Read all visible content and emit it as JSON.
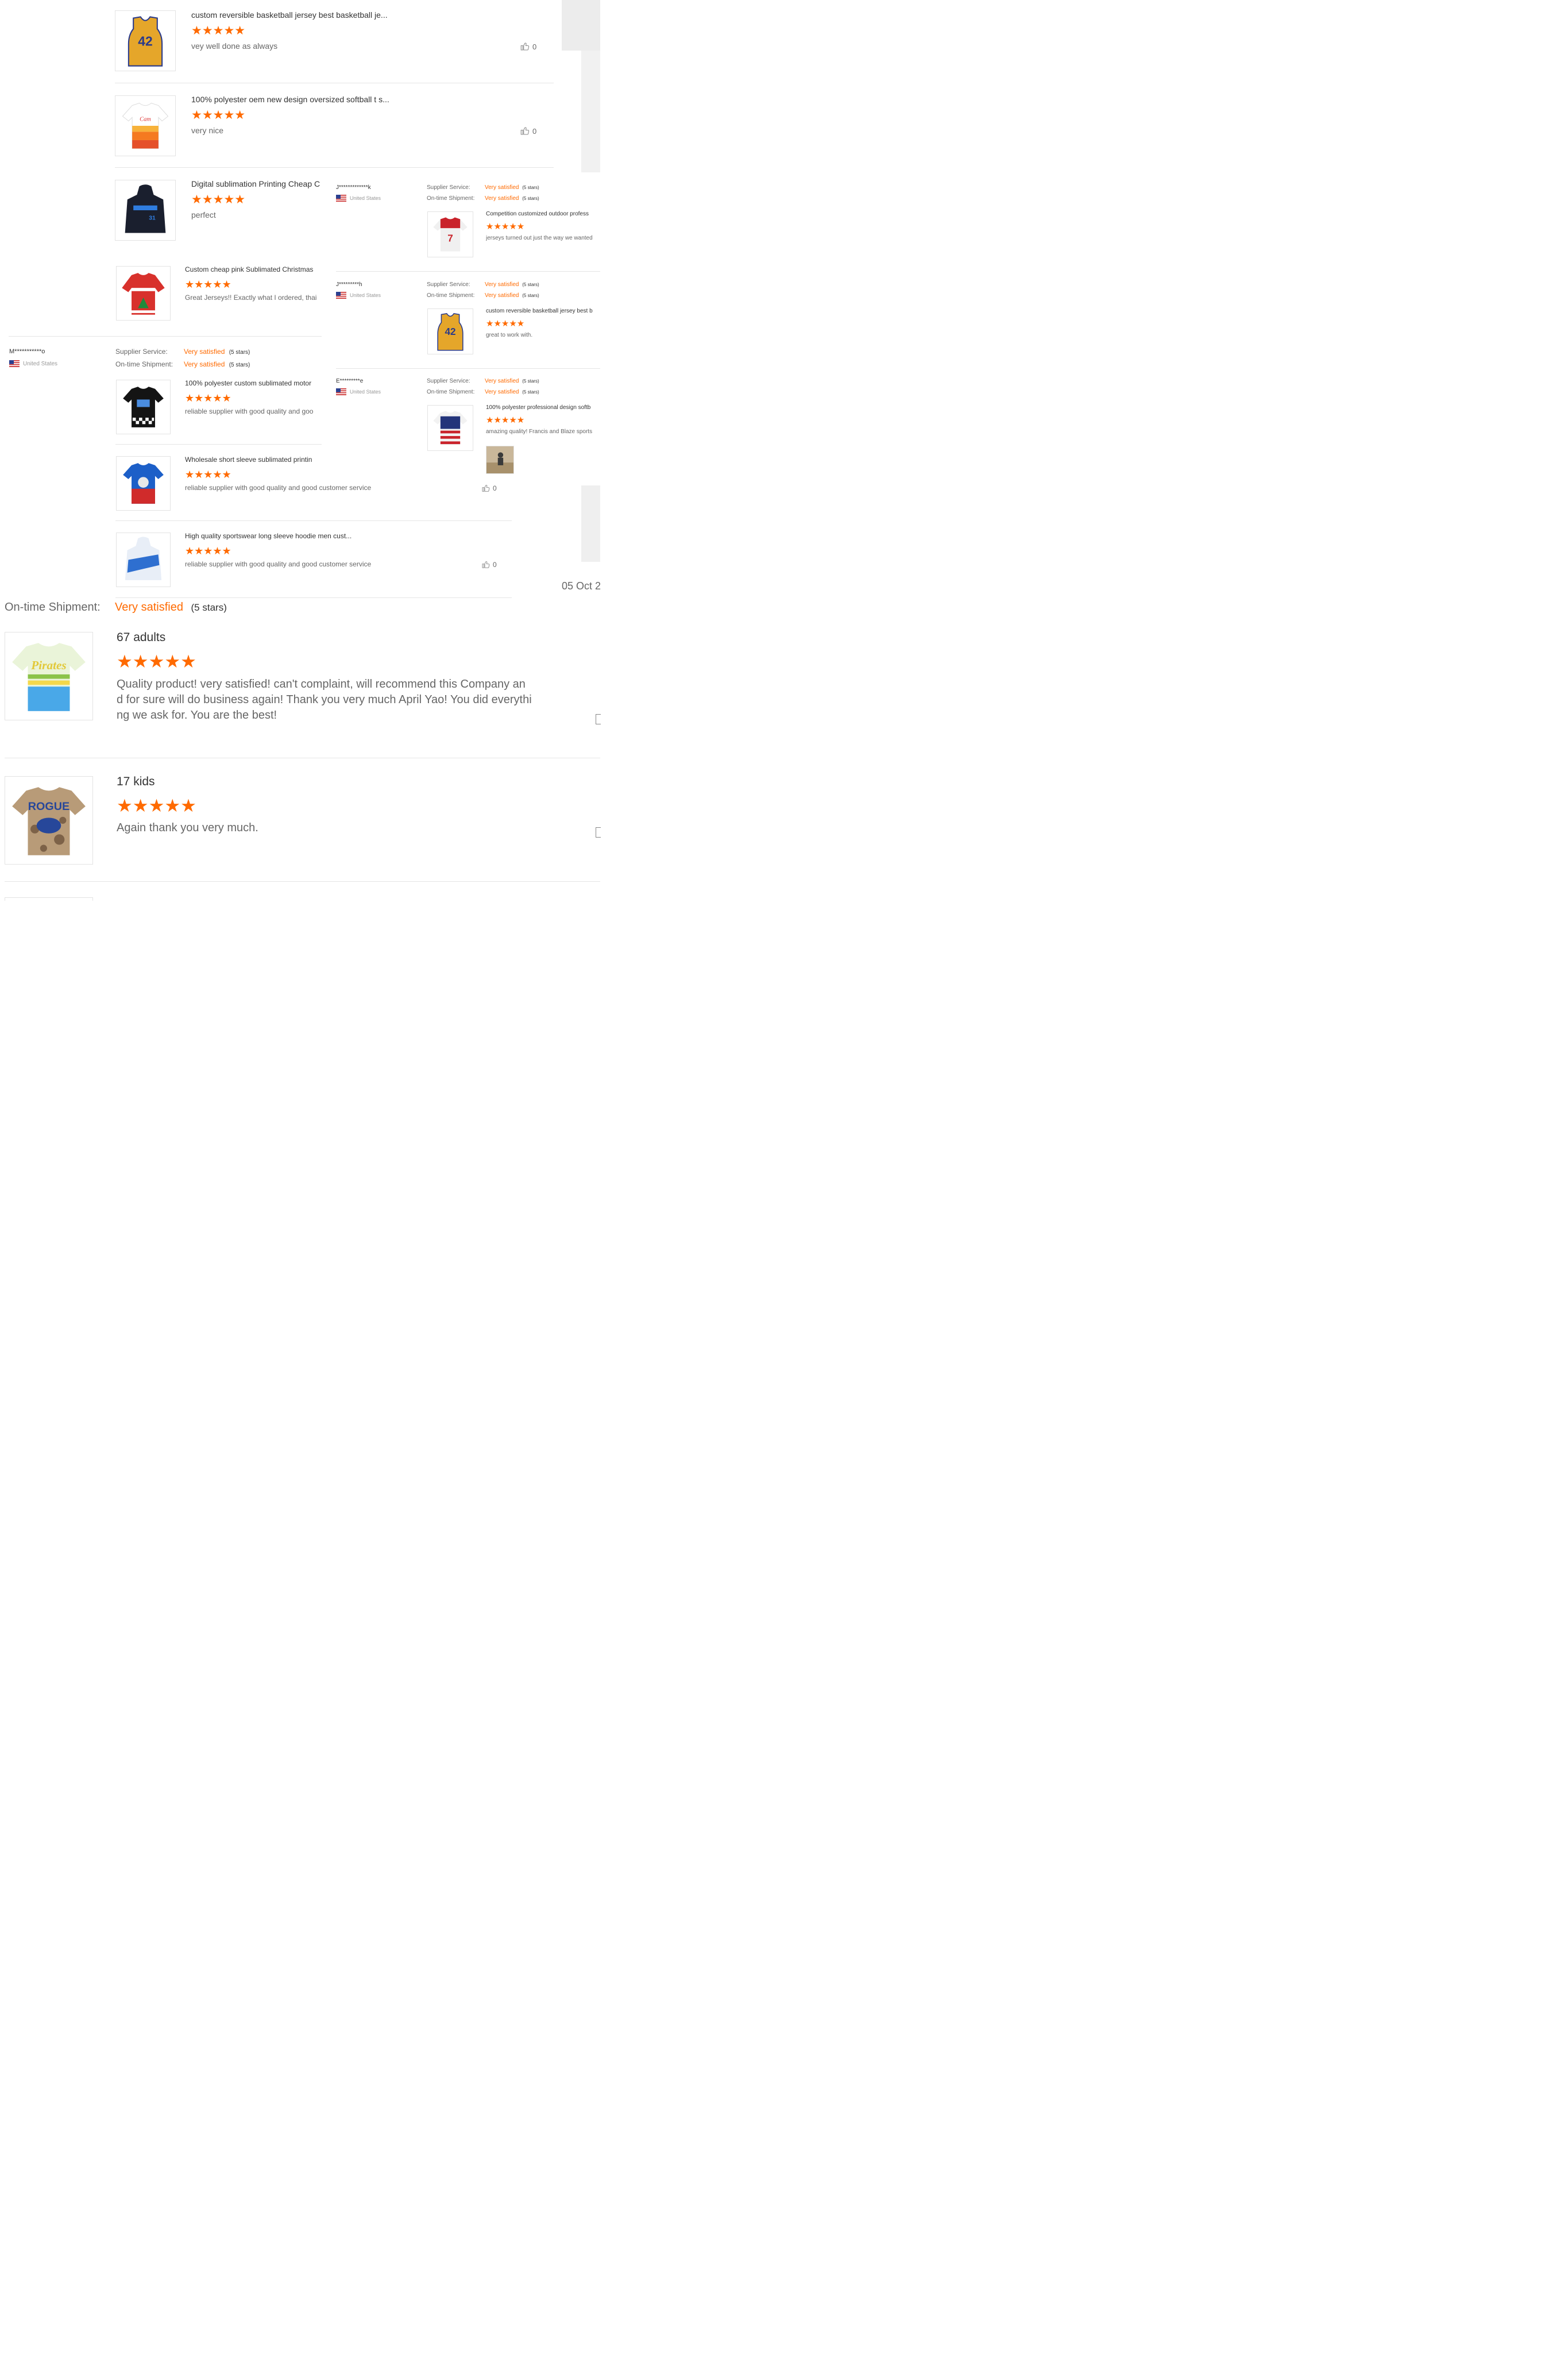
{
  "stars": "★★★★★",
  "colors": {
    "accent": "#ff6a00",
    "rule": "#e5e5e5",
    "text": "#333333",
    "muted": "#666666"
  },
  "top_reviews": [
    {
      "title": "custom reversible basketball jersey best basketball je...",
      "comment": "vey well done as always",
      "likes": "0"
    },
    {
      "title": "100% polyester oem new design oversized softball t s...",
      "comment": "very nice",
      "likes": "0"
    },
    {
      "title": "Digital sublimation Printing Cheap C",
      "comment": "perfect"
    }
  ],
  "mid_reviews": [
    {
      "title": "Custom cheap pink Sublimated Christmas",
      "comment": "Great Jerseys!! Exactly what I ordered, thai"
    },
    {
      "title": "100% polyester custom sublimated motor",
      "comment": "reliable supplier with good quality and goo"
    },
    {
      "title": "Wholesale short sleeve sublimated printin",
      "comment": "reliable supplier with good quality and good customer service",
      "likes": "0"
    },
    {
      "title": "High quality sportswear long sleeve hoodie men cust...",
      "comment": "reliable supplier with good quality and good customer service",
      "likes": "0"
    }
  ],
  "buyer_m": {
    "name": "M***********o",
    "country": "United States"
  },
  "labels": {
    "supplier": "Supplier Service:",
    "shipment": "On-time Shipment:",
    "satisfied": "Very satisfied",
    "stars_note": "(5 stars)"
  },
  "right_reviews": [
    {
      "buyer": "J*************k",
      "country": "United States",
      "title": "Competition customized outdoor profess",
      "comment": "jerseys turned out just the way we wanted"
    },
    {
      "buyer": "J*********h",
      "country": "United States",
      "title": "custom reversible basketball jersey best b",
      "comment": "great to work with."
    },
    {
      "buyer": "E*********e",
      "country": "United States",
      "title": "100% polyester professional design softb",
      "comment": "amazing quality!  Francis and Blaze sports"
    }
  ],
  "date_fragment": "05 Oct 2",
  "bottom": {
    "shipment_label": "On-time Shipment:",
    "satisfied": "Very satisfied",
    "stars_note": "(5 stars)",
    "reviews": [
      {
        "title": "67 adults",
        "comment_lines": [
          "Quality product! very satisfied! can't complaint, will recommend this Company an",
          "d for sure will do business again! Thank you very much April Yao! You did everythi",
          "ng we ask for. You are the best!"
        ]
      },
      {
        "title": "17 kids",
        "comment_lines": [
          "Again thank you very much."
        ]
      }
    ]
  }
}
